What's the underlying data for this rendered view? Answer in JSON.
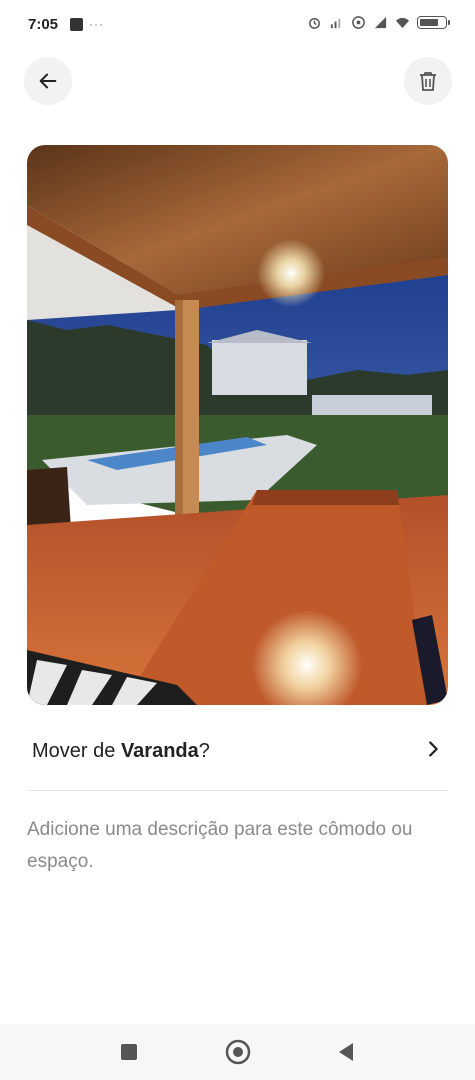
{
  "status_bar": {
    "time": "7:05"
  },
  "header": {
    "back_icon": "arrow-left-icon",
    "delete_icon": "trash-icon"
  },
  "photo": {
    "subject": "Varanda"
  },
  "move_row": {
    "prefix": "Mover de ",
    "room_name": "Varanda",
    "suffix": "?"
  },
  "description": {
    "placeholder": "Adicione uma descrição para este cômodo ou espaço."
  },
  "nav_bar": {
    "icons": [
      "recents-icon",
      "home-icon",
      "back-triangle-icon"
    ]
  }
}
